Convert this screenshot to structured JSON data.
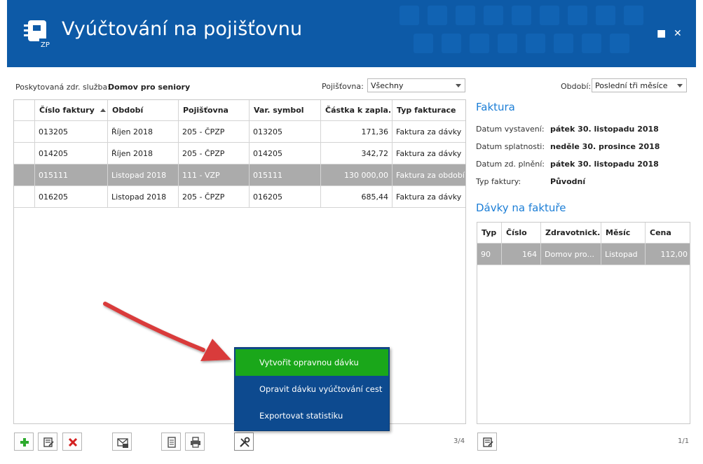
{
  "header": {
    "title": "Vyúčtování na pojišťovnu",
    "logo_text": "ZP",
    "maximize_label": "■",
    "close_label": "✕"
  },
  "filters": {
    "service_label": "Poskytovaná zdr. služba:",
    "service_value": "Domov pro seniory",
    "insurer_label": "Pojišťovna:",
    "insurer_value": "Všechny",
    "period_label": "Období:",
    "period_value": "Poslední tři měsíce"
  },
  "invoices": {
    "columns": [
      "Číslo faktury",
      "Období",
      "Pojišťovna",
      "Var. symbol",
      "Částka k zapla...",
      "Typ fakturace"
    ],
    "rows": [
      {
        "cislo": "013205",
        "obdobi": "Říjen 2018",
        "pojistovna": "205 - ČPZP",
        "vs": "013205",
        "castka": "171,36",
        "typ": "Faktura za dávky"
      },
      {
        "cislo": "014205",
        "obdobi": "Říjen 2018",
        "pojistovna": "205 - ČPZP",
        "vs": "014205",
        "castka": "342,72",
        "typ": "Faktura za dávky"
      },
      {
        "cislo": "015111",
        "obdobi": "Listopad 2018",
        "pojistovna": "111 - VZP",
        "vs": "015111",
        "castka": "130 000,00",
        "typ": "Faktura za období"
      },
      {
        "cislo": "016205",
        "obdobi": "Listopad 2018",
        "pojistovna": "205 - ČPZP",
        "vs": "016205",
        "castka": "685,44",
        "typ": "Faktura za dávky"
      }
    ],
    "selected_index": 2,
    "pager": "3/4"
  },
  "invoice_detail": {
    "title": "Faktura",
    "fields": [
      {
        "label": "Datum vystavení:",
        "value": "pátek 30. listopadu 2018"
      },
      {
        "label": "Datum splatnosti:",
        "value": "neděle 30. prosince 2018"
      },
      {
        "label": "Datum zd. plnění:",
        "value": "pátek 30. listopadu 2018"
      },
      {
        "label": "Typ faktury:",
        "value": "Původní"
      }
    ]
  },
  "batches": {
    "title": "Dávky na faktuře",
    "columns": [
      "Typ",
      "Číslo",
      "Zdravotnick...",
      "Měsíc",
      "Cena"
    ],
    "rows": [
      {
        "typ": "90",
        "cislo": "164",
        "zdrav": "Domov pro...",
        "mesic": "Listopad",
        "cena": "112,00"
      }
    ],
    "pager": "1/1"
  },
  "context_menu": {
    "items": [
      "Vytvořit opravnou dávku",
      "Opravit dávku vyúčtování cest",
      "Exportovat statistiku"
    ],
    "active_index": 0
  },
  "colors": {
    "header_bg": "#0d5aa7",
    "accent_blue": "#1c7ed6",
    "menu_bg": "#0d4a8f",
    "menu_active": "#1aa71a",
    "selected_row": "#ababab",
    "arrow": "#d93a3a"
  },
  "icons": {
    "add": "plus-icon",
    "edit": "edit-icon",
    "delete": "delete-icon",
    "mail": "mail-zp-icon",
    "document": "document-icon",
    "print": "printer-icon",
    "tools": "tools-icon"
  }
}
